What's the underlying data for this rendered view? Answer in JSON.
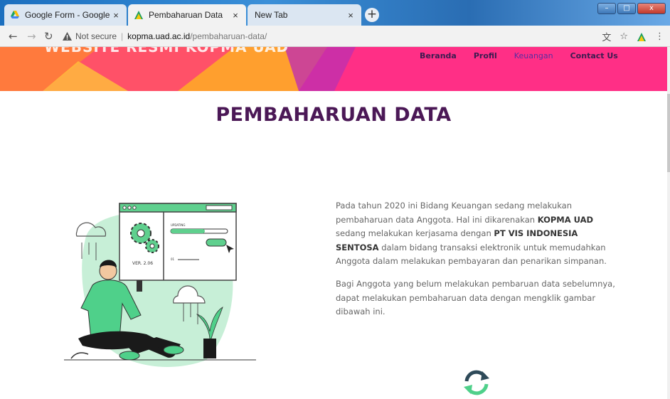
{
  "browser": {
    "tabs": [
      {
        "title": "Google Form - Google Drive",
        "icon": "google-drive-icon"
      },
      {
        "title": "Pembaharuan Data",
        "icon": "kopma-logo-icon"
      },
      {
        "title": "New Tab",
        "icon": ""
      }
    ],
    "new_tab_glyph": "+",
    "address": {
      "security_label": "Not secure",
      "host": "kopma.uad.ac.id",
      "path": "/pembaharuan-data/"
    }
  },
  "site": {
    "title": "WEBSITE RESMI KOPMA UAD",
    "nav": [
      "Beranda",
      "Profil",
      "Keuangan",
      "Contact Us"
    ],
    "active_nav": "Keuangan",
    "accent": "#ff2f86",
    "title_color": "#4b1856"
  },
  "content": {
    "heading": "PEMBAHARUAN DATA",
    "para1": {
      "t1": "Pada tahun 2020 ini Bidang Keuangan sedang melakukan pembaharuan data Anggota. Hal ini dikarenakan ",
      "b1": "KOPMA UAD",
      "t2": " sedang melakukan kerjasama dengan ",
      "b2": "PT VIS INDONESIA SENTOSA",
      "t3": " dalam bidang transaksi elektronik untuk memudahkan Anggota dalam melakukan pembayaran dan penarikan simpanan."
    },
    "para2": "Bagi Anggota yang belum melakukan pembaruan data sebelumnya, dapat melakukan pembaharuan data dengan mengklik gambar dibawah ini.",
    "illustration": {
      "ver_label": "VER. 2.06",
      "status_label": "UPDATING",
      "small_label": "01"
    }
  }
}
